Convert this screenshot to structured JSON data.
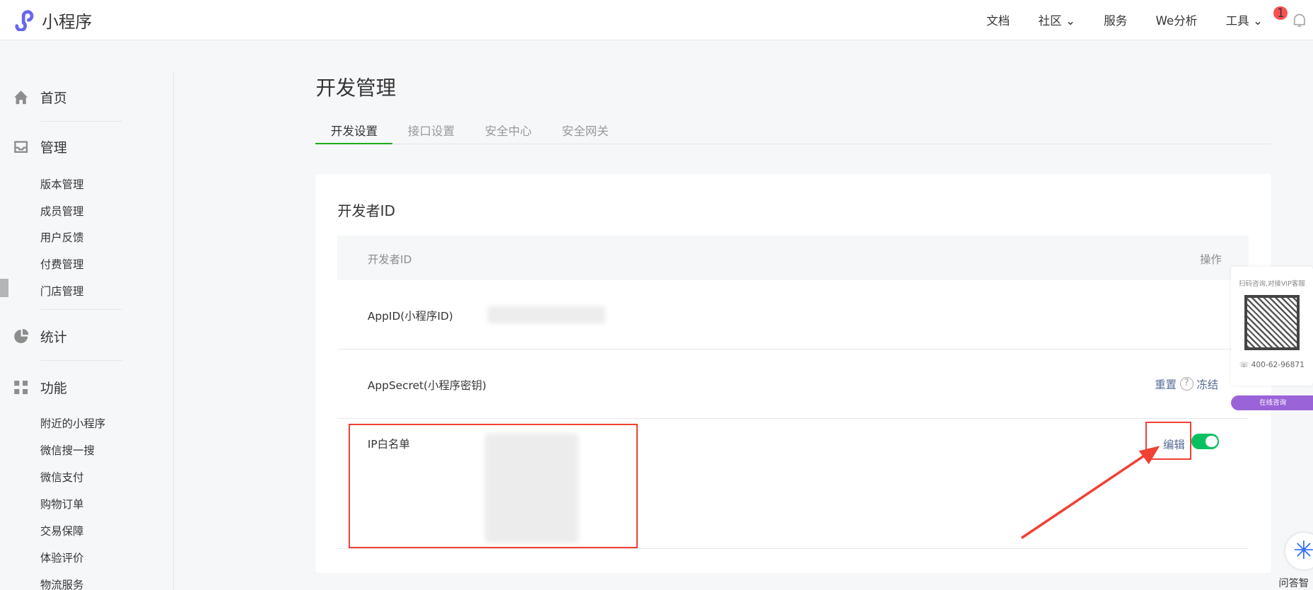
{
  "header": {
    "app_name": "小程序",
    "nav": [
      "文档",
      "社区",
      "服务",
      "We分析",
      "工具"
    ],
    "notifications": "1"
  },
  "sidebar": {
    "home": "首页",
    "manage": "管理",
    "manage_items": [
      "版本管理",
      "成员管理",
      "用户反馈",
      "付费管理",
      "门店管理"
    ],
    "stats": "统计",
    "features": "功能",
    "feature_items": [
      "附近的小程序",
      "微信搜一搜",
      "微信支付",
      "购物订单",
      "交易保障",
      "体验评价",
      "物流服务"
    ]
  },
  "page": {
    "title": "开发管理",
    "tabs": [
      "开发设置",
      "接口设置",
      "安全中心",
      "安全网关"
    ]
  },
  "card": {
    "title": "开发者ID",
    "col_name": "开发者ID",
    "col_action": "操作",
    "rows": {
      "appid": "AppID(小程序ID)",
      "secret": "AppSecret(小程序密钥)",
      "reset": "重置",
      "freeze": "冻结",
      "ip": "IP白名单",
      "edit": "编辑"
    }
  },
  "float": {
    "caption": "扫码咨询,对接VIP客服",
    "phone": "400-62-96871",
    "button": "在线咨询",
    "assistant": "问答智能"
  },
  "colors": {
    "accent": "#1aad19",
    "link": "#576b95",
    "toggle": "#07c160",
    "highlight": "#f04134",
    "consult": "#9b63d8"
  }
}
